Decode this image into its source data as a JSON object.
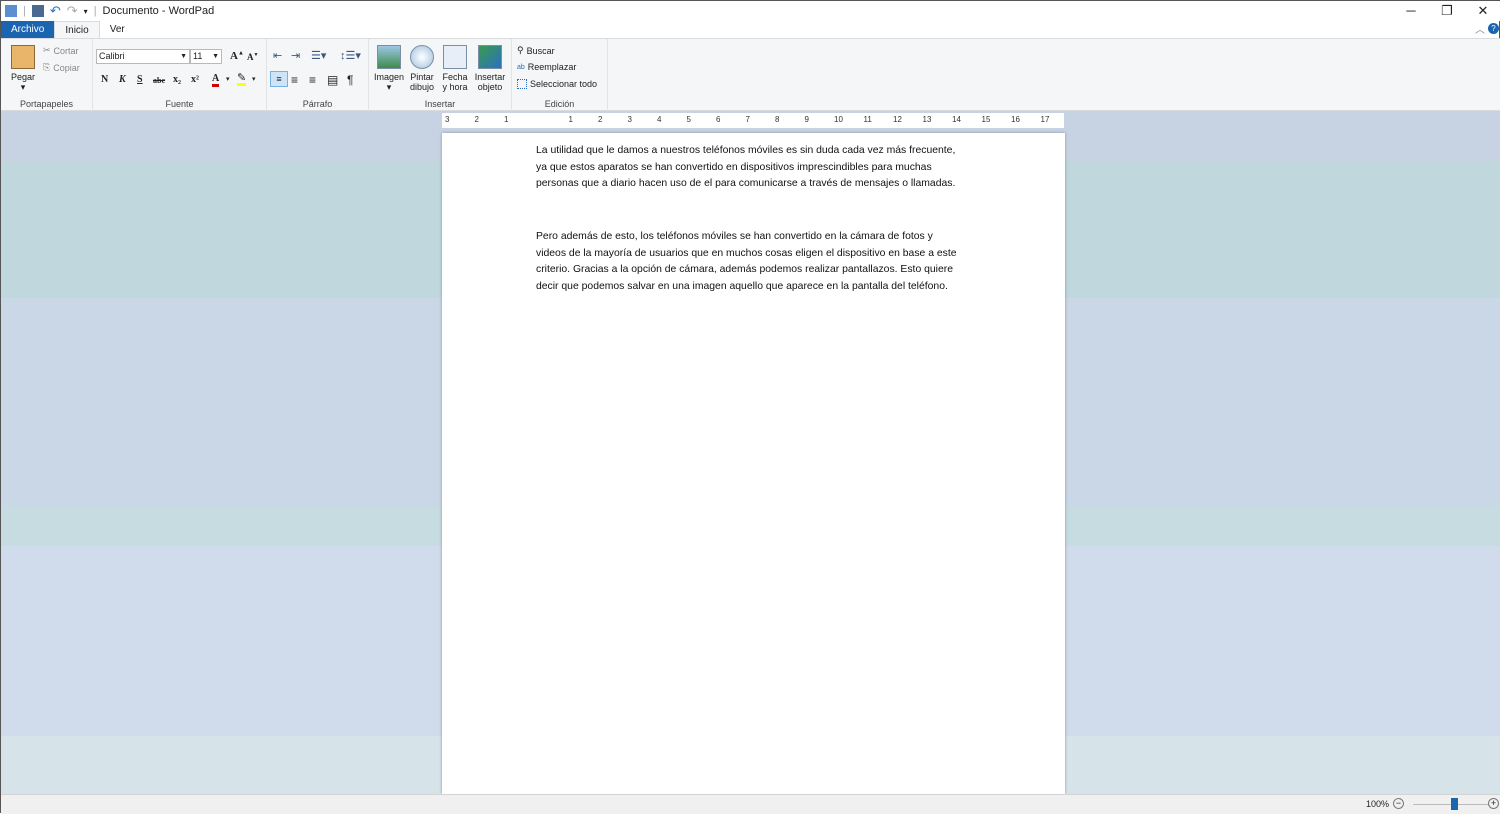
{
  "window": {
    "title": "Documento - WordPad",
    "minimize": "─",
    "restore": "❐",
    "close": "✕"
  },
  "tabs": [
    "Archivo",
    "Inicio",
    "Ver"
  ],
  "clipboard": {
    "paste": "Pegar",
    "cut": "Cortar",
    "copy": "Copiar",
    "label": "Portapapeles"
  },
  "font": {
    "family": "Calibri",
    "size": "11",
    "bold": "N",
    "italic": "K",
    "underline": "S",
    "strike": "abc",
    "sub": "x₂",
    "sup": "x²",
    "label": "Fuente"
  },
  "paragraph": {
    "label": "Párrafo"
  },
  "insert": {
    "image": "Imagen",
    "paint1": "Pintar",
    "paint2": "dibujo",
    "date1": "Fecha",
    "date2": "y hora",
    "obj1": "Insertar",
    "obj2": "objeto",
    "label": "Insertar"
  },
  "edit": {
    "find": "Buscar",
    "replace": "Reemplazar",
    "select_all": "Seleccionar todo",
    "label": "Edición"
  },
  "ruler": [
    "3",
    "2",
    "1",
    "1",
    "2",
    "3",
    "4",
    "5",
    "6",
    "7",
    "8",
    "9",
    "10",
    "11",
    "12",
    "13",
    "14",
    "15",
    "16",
    "17"
  ],
  "document": {
    "paragraphs": [
      [
        "La utilidad que le damos a nuestros teléfonos móviles es sin duda cada vez más frecuente,",
        "ya que estos aparatos se han convertido en dispositivos imprescindibles para muchas",
        "personas que a diario hacen uso de el para comunicarse a través de mensajes o llamadas."
      ],
      [
        "Pero además de esto, los teléfonos móviles se han convertido en la cámara de fotos y",
        "videos de la mayoría de usuarios que en muchos cosas eligen el dispositivo en base a este",
        "criterio. Gracias a la opción de cámara, además podemos realizar pantallazos. Esto quiere",
        "decir que podemos salvar en una imagen aquello que aparece en la pantalla del teléfono."
      ]
    ]
  },
  "status": {
    "zoom": "100%",
    "zoom_level_percent": 100
  }
}
